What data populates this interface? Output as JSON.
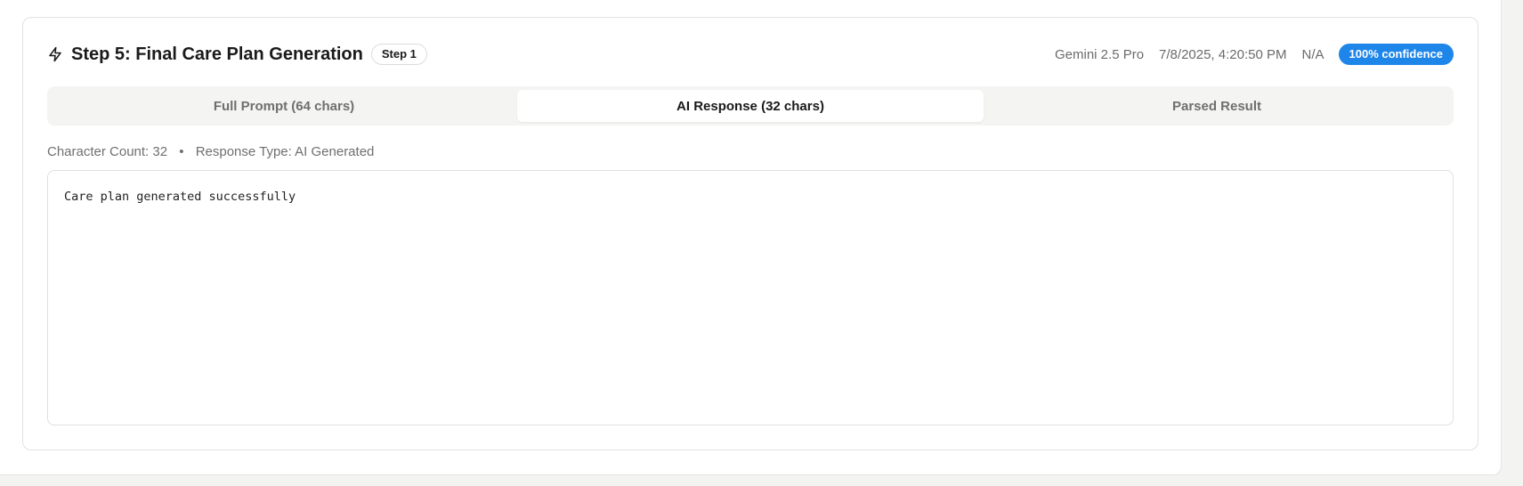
{
  "header": {
    "icon": "bolt-icon",
    "title": "Step 5: Final Care Plan Generation",
    "step_badge": "Step 1",
    "model": "Gemini 2.5 Pro",
    "timestamp": "7/8/2025, 4:20:50 PM",
    "duration": "N/A",
    "confidence": "100% confidence",
    "confidence_color": "#1f86e9"
  },
  "tabs": [
    {
      "label": "Full Prompt (64 chars)",
      "active": false
    },
    {
      "label": "AI Response (32 chars)",
      "active": true
    },
    {
      "label": "Parsed Result",
      "active": false
    }
  ],
  "info": {
    "character_count": "Character Count: 32",
    "separator": "•",
    "response_type": "Response Type: AI Generated"
  },
  "response": {
    "text": "Care plan generated successfully"
  }
}
